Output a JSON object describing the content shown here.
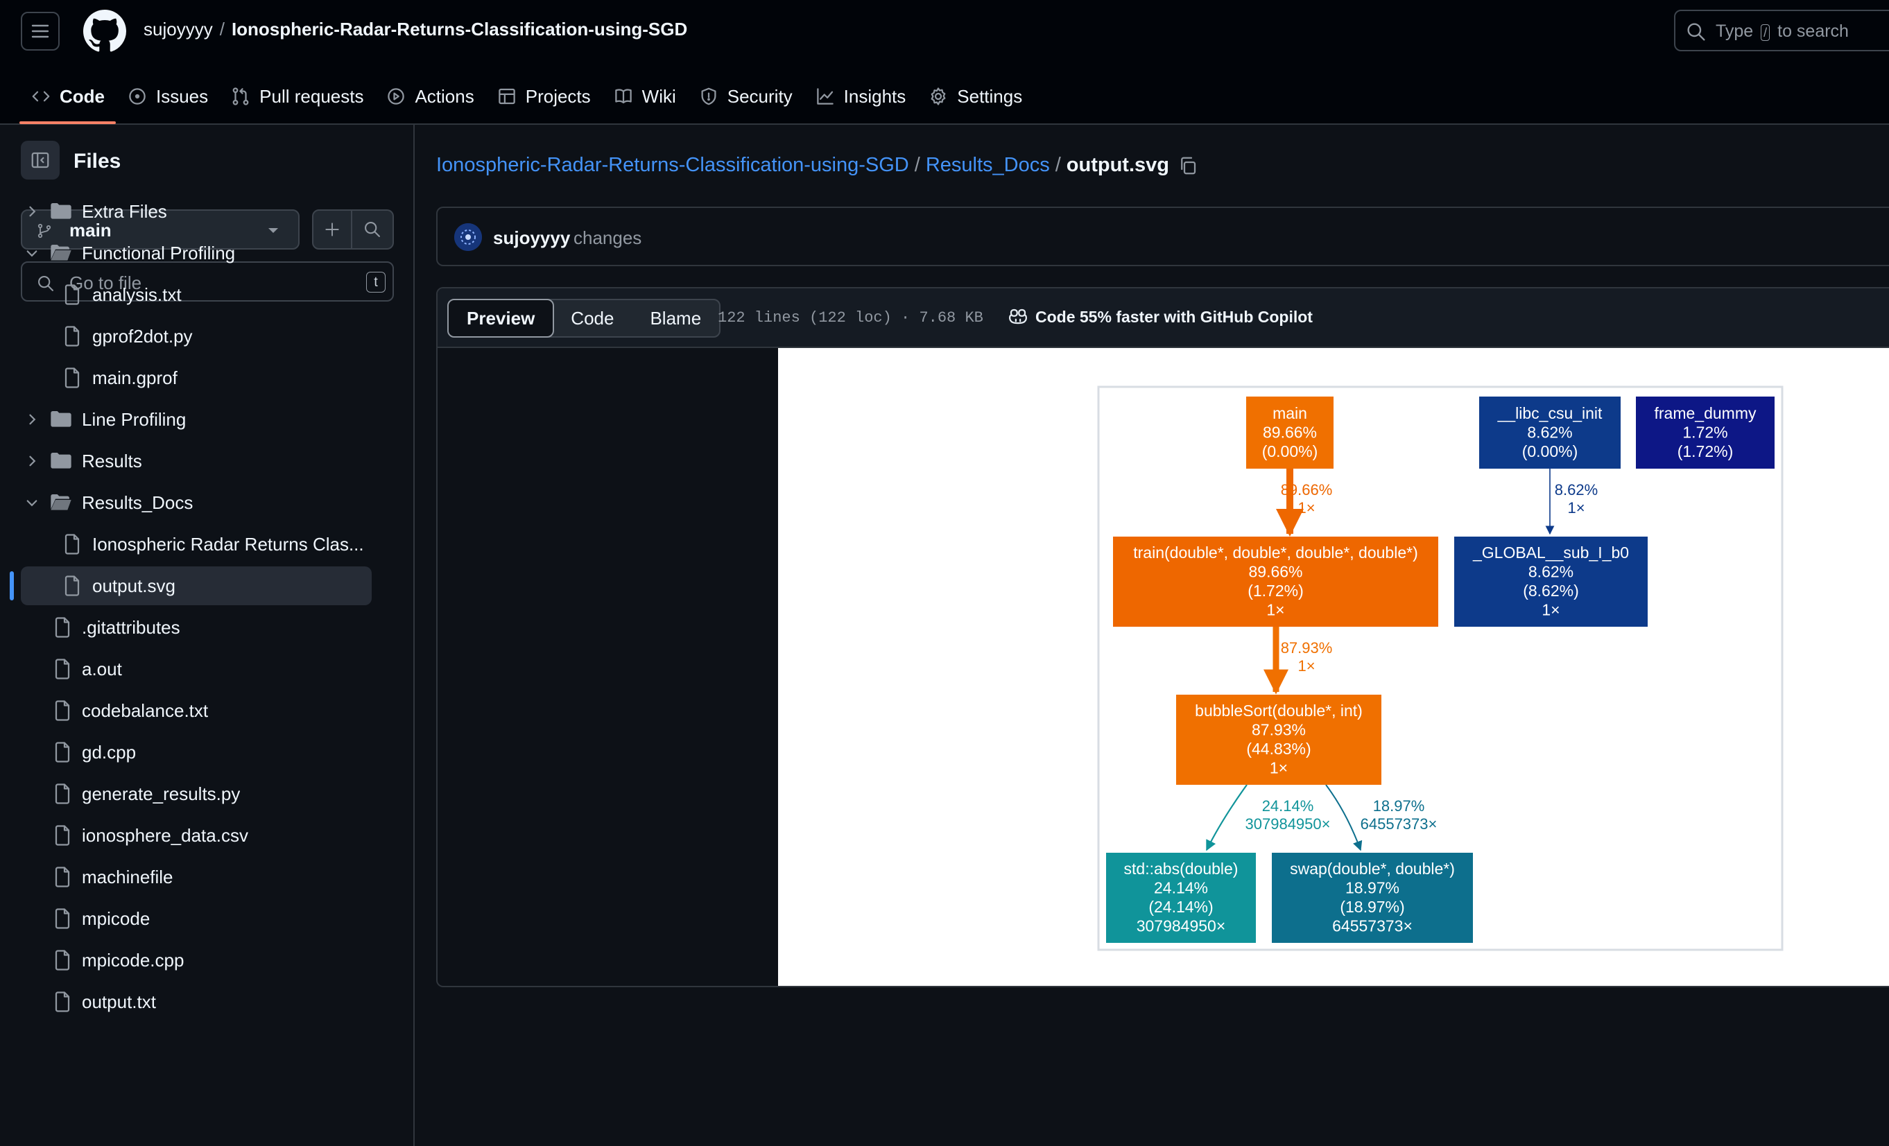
{
  "header": {
    "owner": "sujoyyyy",
    "separator": "/",
    "repo": "Ionospheric-Radar-Returns-Classification-using-SGD",
    "search_prefix": "Type",
    "search_key": "/",
    "search_suffix": "to search"
  },
  "nav": {
    "tabs": [
      {
        "label": "Code",
        "icon": "code-icon",
        "active": true
      },
      {
        "label": "Issues",
        "icon": "issue-opened-icon"
      },
      {
        "label": "Pull requests",
        "icon": "git-pull-request-icon"
      },
      {
        "label": "Actions",
        "icon": "play-icon"
      },
      {
        "label": "Projects",
        "icon": "table-icon"
      },
      {
        "label": "Wiki",
        "icon": "book-icon"
      },
      {
        "label": "Security",
        "icon": "shield-icon"
      },
      {
        "label": "Insights",
        "icon": "graph-icon"
      },
      {
        "label": "Settings",
        "icon": "gear-icon"
      }
    ]
  },
  "sidebar": {
    "title": "Files",
    "branch": "main",
    "goto_placeholder": "Go to file",
    "goto_shortcut": "t",
    "tree": [
      {
        "label": "Extra Files",
        "type": "folder",
        "depth": 0,
        "open": false
      },
      {
        "label": "Functional Profiling",
        "type": "folder",
        "depth": 0,
        "open": true
      },
      {
        "label": "analysis.txt",
        "type": "file",
        "depth": 1
      },
      {
        "label": "gprof2dot.py",
        "type": "file",
        "depth": 1
      },
      {
        "label": "main.gprof",
        "type": "file",
        "depth": 1
      },
      {
        "label": "Line Profiling",
        "type": "folder",
        "depth": 0,
        "open": false
      },
      {
        "label": "Results",
        "type": "folder",
        "depth": 0,
        "open": false
      },
      {
        "label": "Results_Docs",
        "type": "folder",
        "depth": 0,
        "open": true
      },
      {
        "label": "Ionospheric Radar Returns Clas...",
        "type": "file",
        "depth": 1
      },
      {
        "label": "output.svg",
        "type": "file",
        "depth": 1,
        "selected": true
      },
      {
        "label": ".gitattributes",
        "type": "file",
        "depth": 0
      },
      {
        "label": "a.out",
        "type": "file",
        "depth": 0
      },
      {
        "label": "codebalance.txt",
        "type": "file",
        "depth": 0
      },
      {
        "label": "gd.cpp",
        "type": "file",
        "depth": 0
      },
      {
        "label": "generate_results.py",
        "type": "file",
        "depth": 0
      },
      {
        "label": "ionosphere_data.csv",
        "type": "file",
        "depth": 0
      },
      {
        "label": "machinefile",
        "type": "file",
        "depth": 0
      },
      {
        "label": "mpicode",
        "type": "file",
        "depth": 0
      },
      {
        "label": "mpicode.cpp",
        "type": "file",
        "depth": 0
      },
      {
        "label": "output.txt",
        "type": "file",
        "depth": 0
      }
    ]
  },
  "breadcrumb": {
    "repo": "Ionospheric-Radar-Returns-Classification-using-SGD",
    "folder": "Results_Docs",
    "file": "output.svg",
    "sep": "/"
  },
  "commit": {
    "author": "sujoyyyy",
    "message": "changes"
  },
  "file_view": {
    "tabs": [
      "Preview",
      "Code",
      "Blame"
    ],
    "active_tab": "Preview",
    "meta": "122 lines (122 loc) · 7.68 KB",
    "copilot": "Code 55% faster with GitHub Copilot"
  },
  "graph": {
    "nodes": [
      {
        "id": "main",
        "lines": [
          "main",
          "89.66%",
          "(0.00%)"
        ],
        "color": "#f07000"
      },
      {
        "id": "train",
        "lines": [
          "train(double*, double*, double*, double*)",
          "89.66%",
          "(1.72%)",
          "1×"
        ],
        "color": "#ee6700"
      },
      {
        "id": "bubble",
        "lines": [
          "bubbleSort(double*, int)",
          "87.93%",
          "(44.83%)",
          "1×"
        ],
        "color": "#f07000"
      },
      {
        "id": "abs",
        "lines": [
          "std::abs(double)",
          "24.14%",
          "(24.14%)",
          "307984950×"
        ],
        "color": "#10949a"
      },
      {
        "id": "swap",
        "lines": [
          "swap(double*, double*)",
          "18.97%",
          "(18.97%)",
          "64557373×"
        ],
        "color": "#0d6f8d"
      },
      {
        "id": "libc",
        "lines": [
          "__libc_csu_init",
          "8.62%",
          "(0.00%)"
        ],
        "color": "#0d3a8a"
      },
      {
        "id": "global",
        "lines": [
          "_GLOBAL__sub_I_b0",
          "8.62%",
          "(8.62%)",
          "1×"
        ],
        "color": "#0d3a8a"
      },
      {
        "id": "dummy",
        "lines": [
          "frame_dummy",
          "1.72%",
          "(1.72%)"
        ],
        "color": "#0d1786"
      }
    ],
    "edges": [
      {
        "id": "main-train",
        "lines": [
          "89.66%",
          "1×"
        ],
        "color": "#ee6700"
      },
      {
        "id": "train-bubble",
        "lines": [
          "87.93%",
          "1×"
        ],
        "color": "#f07000"
      },
      {
        "id": "bubble-abs",
        "lines": [
          "24.14%",
          "307984950×"
        ],
        "color": "#10949a"
      },
      {
        "id": "bubble-swap",
        "lines": [
          "18.97%",
          "64557373×"
        ],
        "color": "#0d6f8d"
      },
      {
        "id": "libc-global",
        "lines": [
          "8.62%",
          "1×"
        ],
        "color": "#0d3a8a"
      }
    ]
  }
}
